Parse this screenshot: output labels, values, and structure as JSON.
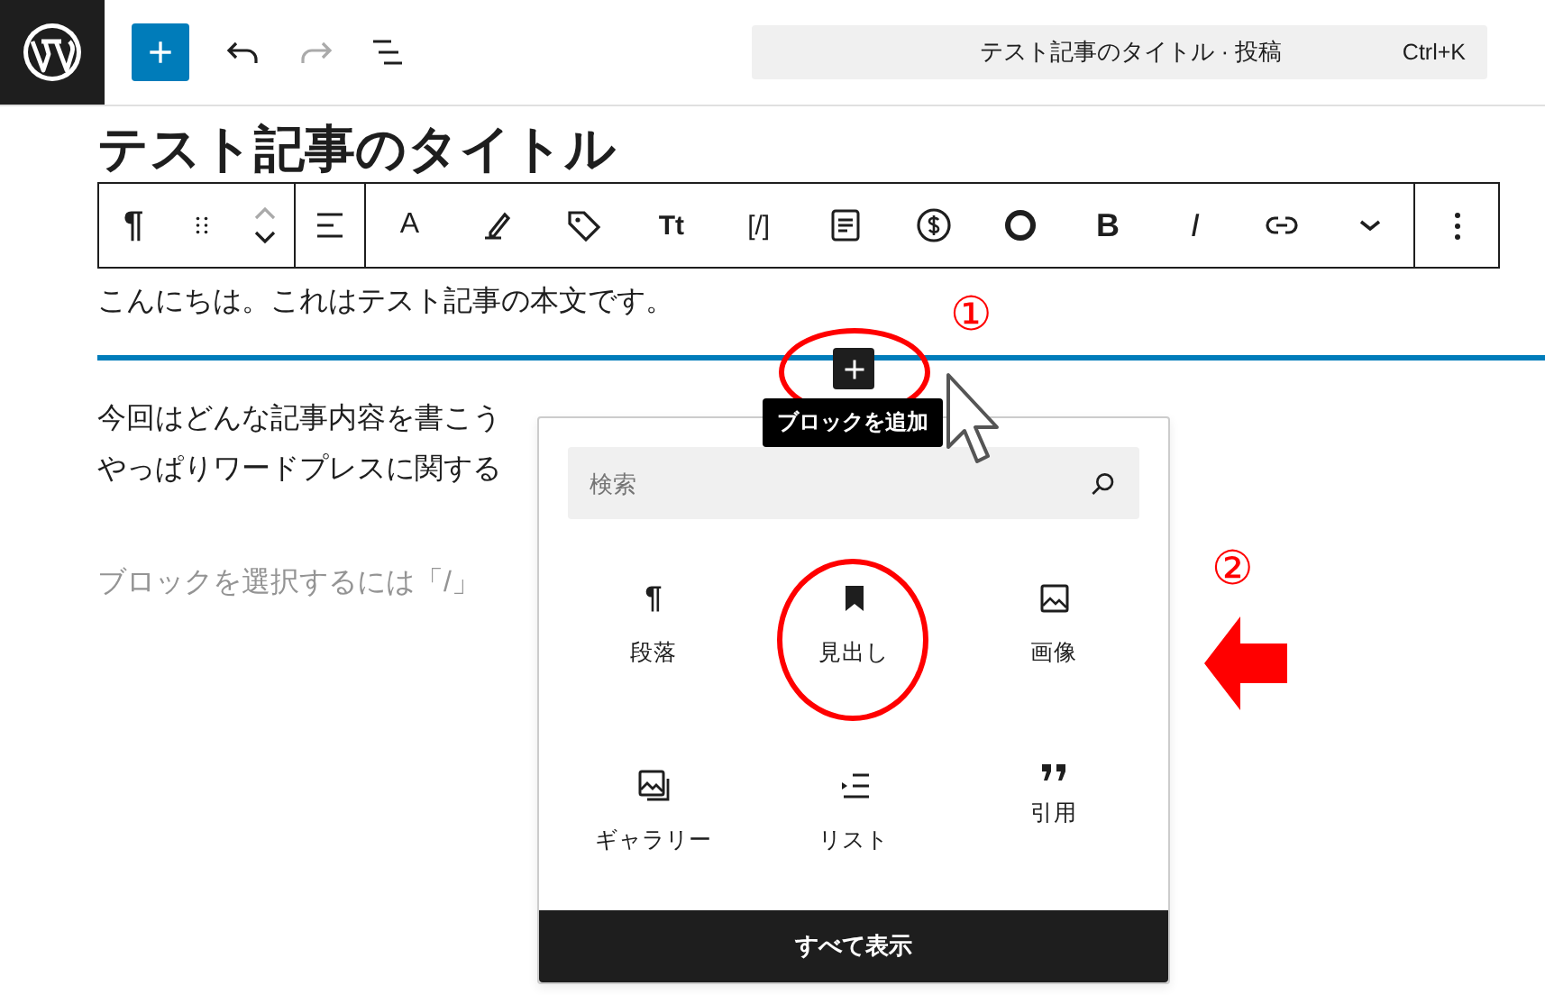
{
  "command_bar": {
    "title": "テスト記事のタイトル · 投稿",
    "shortcut": "Ctrl+K"
  },
  "toolbar": {
    "paragraph": "¶",
    "text_color": "A",
    "font_size": "Tt",
    "shortcode": "[/]",
    "bold": "B",
    "italic": "I"
  },
  "post": {
    "title": "テスト記事のタイトル",
    "paragraphs": [
      "こんにちは。これはテスト記事の本文です。",
      "今回はどんな記事内容を書こう",
      "やっぱりワードプレスに関する"
    ],
    "placeholder": "ブロックを選択するには「/」"
  },
  "tooltip": "ブロックを追加",
  "inserter": {
    "search_placeholder": "検索",
    "blocks": [
      {
        "kind": "paragraph",
        "label": "段落",
        "glyph": "¶"
      },
      {
        "kind": "heading",
        "label": "見出し"
      },
      {
        "kind": "image",
        "label": "画像"
      },
      {
        "kind": "gallery",
        "label": "ギャラリー"
      },
      {
        "kind": "list",
        "label": "リスト"
      },
      {
        "kind": "quote",
        "label": "引用"
      }
    ],
    "browse_all": "すべて表示"
  },
  "annotations": {
    "step_marks": [
      "①",
      "②"
    ]
  }
}
